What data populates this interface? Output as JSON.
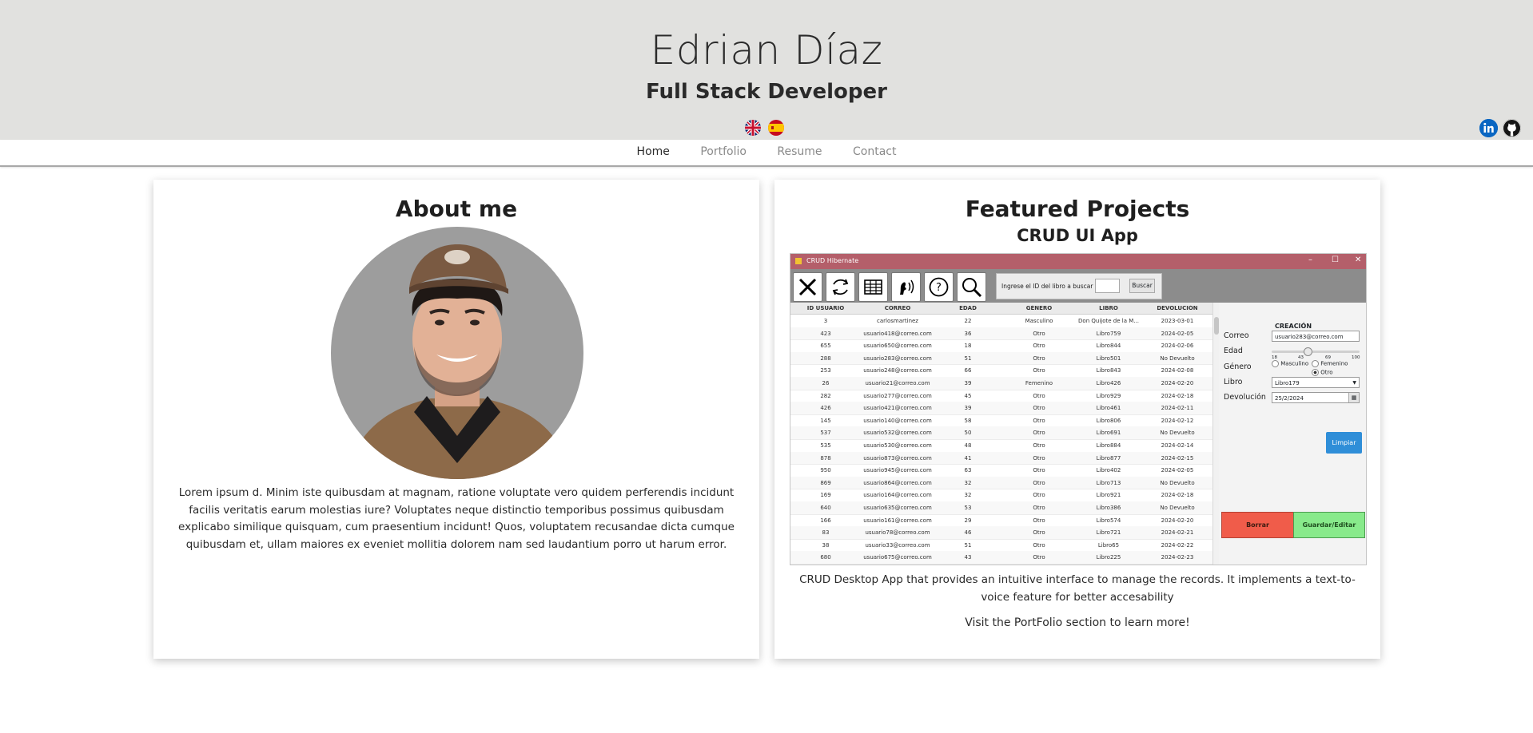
{
  "header": {
    "name": "Edrian Díaz",
    "role": "Full Stack Developer",
    "languages": [
      "english-flag-icon",
      "spanish-flag-icon"
    ],
    "social": [
      "linkedin-icon",
      "github-icon"
    ]
  },
  "nav": {
    "items": [
      {
        "label": "Home",
        "active": true
      },
      {
        "label": "Portfolio",
        "active": false
      },
      {
        "label": "Resume",
        "active": false
      },
      {
        "label": "Contact",
        "active": false
      }
    ]
  },
  "about": {
    "title": "About me",
    "text": "Lorem ipsum d. Minim iste quibusdam at magnam, ratione voluptate vero quidem perferendis incidunt facilis veritatis earum molestias iure? Voluptates neque distinctio temporibus possimus quibusdam explicabo similique quisquam, cum praesentium incidunt! Quos, voluptatem recusandae dicta cumque quibusdam et, ullam maiores ex eveniet mollitia dolorem nam sed laudantium porro ut harum error."
  },
  "projects": {
    "title": "Featured Projects",
    "project_title": "CRUD UI App",
    "description": "CRUD Desktop App that provides an intuitive interface to manage the records. It implements a text-to-voice feature for better accesability",
    "link_text": "Visit the PortFolio section to learn more!"
  },
  "app": {
    "window_title": "CRUD Hibernate",
    "window_controls": [
      "–",
      "☐",
      "✕"
    ],
    "toolbar_icons": [
      "close-icon",
      "refresh-icon",
      "table-icon",
      "voice-icon",
      "help-icon",
      "search-icon"
    ],
    "search_label": "Ingrese el ID del libro a buscar",
    "search_button": "Buscar",
    "columns": [
      "ID USUARIO",
      "CORREO",
      "EDAD",
      "GÉNERO",
      "LIBRO",
      "DEVOLUCIÓN"
    ],
    "rows": [
      [
        "3",
        "carlosmartinez",
        "22",
        "Masculino",
        "Don Quijote de la M...",
        "2023-03-01"
      ],
      [
        "423",
        "usuario418@correo.com",
        "36",
        "Otro",
        "Libro759",
        "2024-02-05"
      ],
      [
        "655",
        "usuario650@correo.com",
        "18",
        "Otro",
        "Libro844",
        "2024-02-06"
      ],
      [
        "288",
        "usuario283@correo.com",
        "51",
        "Otro",
        "Libro501",
        "No Devuelto"
      ],
      [
        "253",
        "usuario248@correo.com",
        "66",
        "Otro",
        "Libro843",
        "2024-02-08"
      ],
      [
        "26",
        "usuario21@correo.com",
        "39",
        "Femenino",
        "Libro426",
        "2024-02-20"
      ],
      [
        "282",
        "usuario277@correo.com",
        "45",
        "Otro",
        "Libro929",
        "2024-02-18"
      ],
      [
        "426",
        "usuario421@correo.com",
        "39",
        "Otro",
        "Libro461",
        "2024-02-11"
      ],
      [
        "145",
        "usuario140@correo.com",
        "58",
        "Otro",
        "Libro806",
        "2024-02-12"
      ],
      [
        "537",
        "usuario532@correo.com",
        "50",
        "Otro",
        "Libro691",
        "No Devuelto"
      ],
      [
        "535",
        "usuario530@correo.com",
        "48",
        "Otro",
        "Libro884",
        "2024-02-14"
      ],
      [
        "878",
        "usuario873@correo.com",
        "41",
        "Otro",
        "Libro877",
        "2024-02-15"
      ],
      [
        "950",
        "usuario945@correo.com",
        "63",
        "Otro",
        "Libro402",
        "2024-02-05"
      ],
      [
        "869",
        "usuario864@correo.com",
        "32",
        "Otro",
        "Libro713",
        "No Devuelto"
      ],
      [
        "169",
        "usuario164@correo.com",
        "32",
        "Otro",
        "Libro921",
        "2024-02-18"
      ],
      [
        "640",
        "usuario635@correo.com",
        "53",
        "Otro",
        "Libro386",
        "No Devuelto"
      ],
      [
        "166",
        "usuario161@correo.com",
        "29",
        "Otro",
        "Libro574",
        "2024-02-20"
      ],
      [
        "83",
        "usuario78@correo.com",
        "46",
        "Otro",
        "Libro721",
        "2024-02-21"
      ],
      [
        "38",
        "usuario33@correo.com",
        "51",
        "Otro",
        "Libro65",
        "2024-02-22"
      ],
      [
        "680",
        "usuario675@correo.com",
        "43",
        "Otro",
        "Libro225",
        "2024-02-23"
      ]
    ],
    "form": {
      "heading": "CREACIÓN",
      "email_label": "Correo",
      "email_value": "usuario283@correo.com",
      "age_label": "Edad",
      "age_ticks": [
        "18",
        "43",
        "69",
        "100"
      ],
      "age_value": 51,
      "gender_label": "Género",
      "gender_options": [
        "Masculino",
        "Femenino",
        "Otro"
      ],
      "gender_selected": "Otro",
      "book_label": "Libro",
      "book_value": "Libro179",
      "return_label": "Devolución",
      "return_value": "25/2/2024",
      "clear_button": "Limpiar",
      "delete_button": "Borrar",
      "save_button": "Guardar/Editar"
    }
  }
}
